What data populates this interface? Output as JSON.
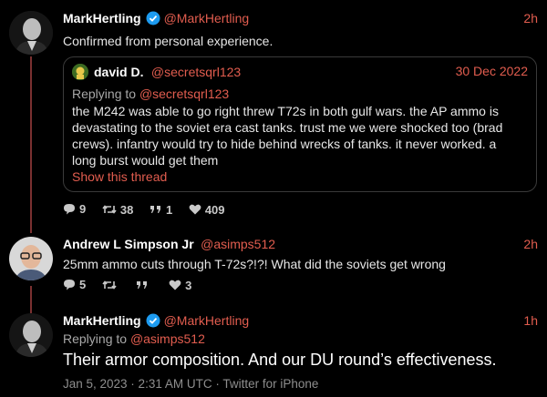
{
  "tweet1": {
    "name": "MarkHertling",
    "handle": "@MarkHertling",
    "time": "2h",
    "text": "Confirmed from personal experience.",
    "quote": {
      "name": "david D.",
      "handle": "@secretsqrl123",
      "date": "30 Dec 2022",
      "replying_prefix": "Replying to ",
      "replying_handle": "@secretsqrl123",
      "lines": [
        "the M242 was able to go right threw T72s in both gulf wars.  the AP ammo is",
        "devastating to the soviet era cast tanks.  trust me we were shocked too (brad",
        "crews).  infantry would try to hide behind wrecks of tanks. it never worked. a",
        "long burst would get them"
      ],
      "show_thread": "Show this thread"
    },
    "actions": {
      "replies": "9",
      "retweets": "38",
      "quotes": "1",
      "likes": "409"
    }
  },
  "tweet2": {
    "name": "Andrew L Simpson Jr",
    "handle": "@asimps512",
    "time": "2h",
    "text": "25mm ammo cuts through T-72s?!?! What did the soviets get wrong",
    "actions": {
      "replies": "5",
      "likes": "3"
    }
  },
  "tweet3": {
    "name": "MarkHertling",
    "handle": "@MarkHertling",
    "time": "1h",
    "replying_prefix": "Replying to ",
    "replying_handle": "@asimps512",
    "text": "Their armor composition. And our DU round’s effectiveness.",
    "meta": "Jan 5, 2023 · 2:31 AM UTC · Twitter for iPhone"
  },
  "colors": {
    "accent": "#e25d4f",
    "verified": "#1d9bf0",
    "thread_line": "#7a3030"
  }
}
